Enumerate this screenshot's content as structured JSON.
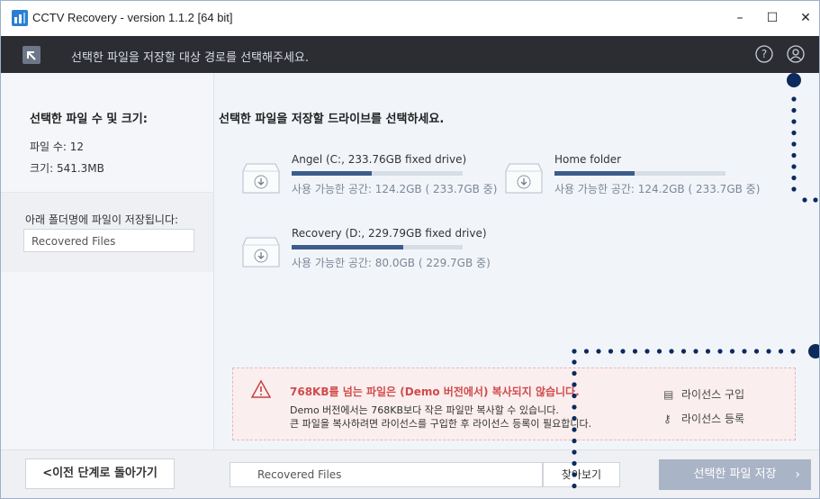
{
  "window": {
    "title": "CCTV Recovery - version 1.1.2 [64 bit]",
    "minimize": "–",
    "maximize": "☐",
    "close": "✕"
  },
  "header": {
    "instruction": "선택한 파일을 저장할 대상 경로를 선택해주세요."
  },
  "sidebar": {
    "summary_title": "선택한 파일 수 및 크기:",
    "file_count": "파일 수: 12",
    "file_size": "크기: 541.3MB",
    "folder_label": "아래 폴더명에 파일이 저장됩니다:",
    "folder_value": "Recovered Files"
  },
  "main": {
    "title": "선택한 파일을 저장할 드라이브를 선택하세요.",
    "drives": [
      {
        "name": "Angel (C:, 233.76GB fixed drive)",
        "free": "사용 가능한 공간: 124.2GB ( 233.7GB 중)",
        "used_fraction": 0.47
      },
      {
        "name": "Home folder",
        "free": "사용 가능한 공간: 124.2GB ( 233.7GB 중)",
        "used_fraction": 0.47
      },
      {
        "name": "Recovery (D:, 229.79GB fixed drive)",
        "free": "사용 가능한 공간: 80.0GB ( 229.7GB 중)",
        "used_fraction": 0.65
      }
    ]
  },
  "warning": {
    "title": "768KB를 넘는 파일은 (Demo 버전에서) 복사되지 않습니다.",
    "line1": "Demo 버전에서는 768KB보다 작은 파일만 복사할 수 있습니다.",
    "line2": "큰 파일을 복사하려면 라이선스를 구입한 후 라이선스 등록이 필요합니다.",
    "buy_license": "라이선스 구입",
    "register_license": "라이선스 등록"
  },
  "bottom": {
    "prev_button": "<이전 단계로 돌아가기",
    "path_value": "Recovered Files",
    "browse_button": "찾아보기",
    "save_button": "선택한 파일 저장"
  },
  "colors": {
    "header_bg": "#2b2d33",
    "accent": "#3d5c8c",
    "warning_text": "#d14b4b",
    "annotation_dots": "#0d2a5c"
  }
}
